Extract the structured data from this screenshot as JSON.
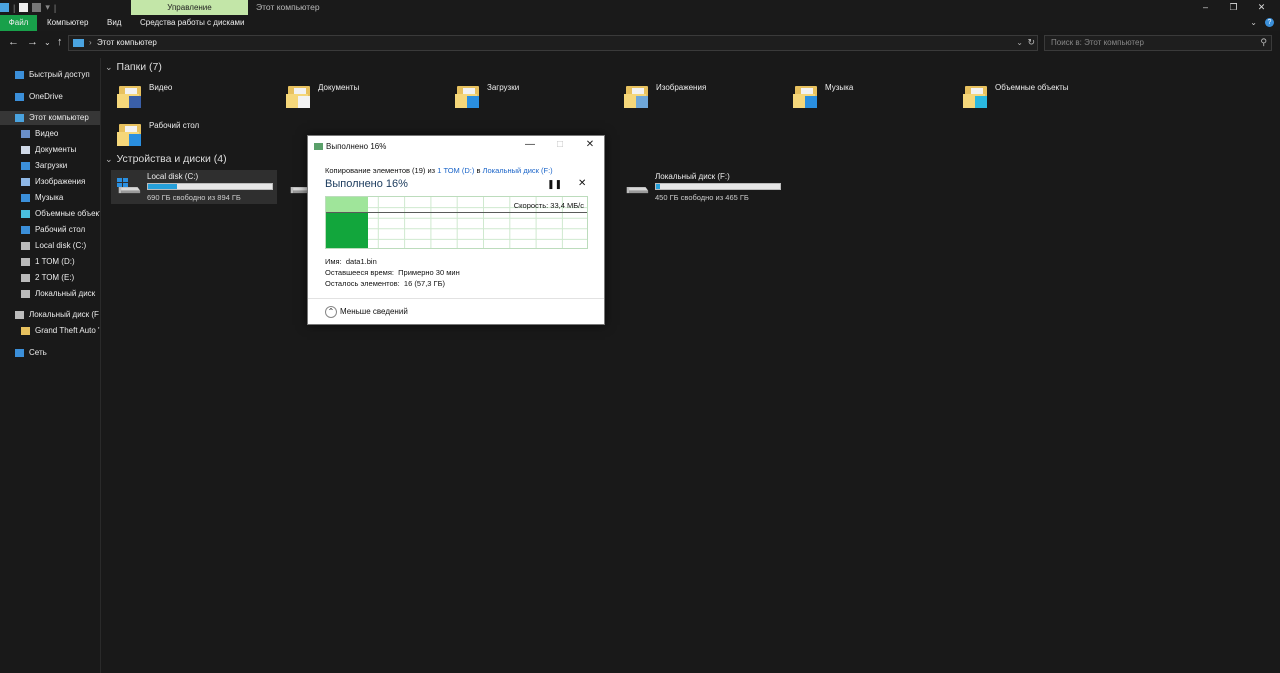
{
  "titlebar": {
    "manage_tab": "Управление",
    "title": "Этот компьютер",
    "controls": [
      "–",
      "❐",
      "✕"
    ]
  },
  "ribbon": {
    "tabs": [
      "Файл",
      "Компьютер",
      "Вид",
      "Средства работы с дисками"
    ],
    "right_icons": [
      "chevron-down-icon",
      "help-icon"
    ]
  },
  "address": {
    "back": "←",
    "forward": "→",
    "dropdown": "⌄",
    "up": "↑",
    "path": "Этот компьютер",
    "search_placeholder": "Поиск в: Этот компьютер"
  },
  "sidebar": {
    "items": [
      {
        "label": "Быстрый доступ",
        "icon": "star-icon",
        "color": "#3b8fd9"
      },
      {
        "label": "OneDrive",
        "icon": "cloud-icon",
        "color": "#3b8fd9"
      },
      {
        "label": "Этот компьютер",
        "icon": "pc-icon",
        "color": "#4aa3df"
      },
      {
        "label": "Видео",
        "icon": "video-icon",
        "color": "#6a8fc9"
      },
      {
        "label": "Документы",
        "icon": "documents-icon",
        "color": "#cfd8e6"
      },
      {
        "label": "Загрузки",
        "icon": "downloads-icon",
        "color": "#3b8fd9"
      },
      {
        "label": "Изображения",
        "icon": "images-icon",
        "color": "#8fb8e6"
      },
      {
        "label": "Музыка",
        "icon": "music-icon",
        "color": "#3b8fd9"
      },
      {
        "label": "Объемные объекты",
        "icon": "3d-objects-icon",
        "color": "#4ac0e0"
      },
      {
        "label": "Рабочий стол",
        "icon": "desktop-icon",
        "color": "#3b8fd9"
      },
      {
        "label": "Local disk (C:)",
        "icon": "drive-icon",
        "color": "#bbbbbb"
      },
      {
        "label": "1 ТОМ (D:)",
        "icon": "drive-icon",
        "color": "#bbbbbb"
      },
      {
        "label": "2 ТОМ (E:)",
        "icon": "drive-icon",
        "color": "#bbbbbb"
      },
      {
        "label": "Локальный диск",
        "icon": "drive-icon",
        "color": "#bbbbbb"
      },
      {
        "label": "Локальный диск (F",
        "icon": "drive-icon",
        "color": "#bbbbbb"
      },
      {
        "label": "Grand Theft Auto '",
        "icon": "folder-icon",
        "color": "#e7c15f"
      },
      {
        "label": "Сеть",
        "icon": "network-icon",
        "color": "#3b8fd9"
      }
    ]
  },
  "folders_group": {
    "chevron": "⌄",
    "label": "Папки (7)",
    "items": [
      {
        "name": "Видео",
        "badge": "video-icon"
      },
      {
        "name": "Документы",
        "badge": "documents-icon"
      },
      {
        "name": "Загрузки",
        "badge": "downloads-icon"
      },
      {
        "name": "Изображения",
        "badge": "images-icon"
      },
      {
        "name": "Музыка",
        "badge": "music-icon"
      },
      {
        "name": "Объемные объекты",
        "badge": "3d-objects-icon"
      },
      {
        "name": "Рабочий стол",
        "badge": "desktop-icon"
      }
    ]
  },
  "drives_group": {
    "chevron": "⌄",
    "label": "Устройства и диски (4)",
    "items": [
      {
        "name": "Local disk (C:)",
        "free": "690 ГБ свободно из 894 ГБ",
        "used_fraction": 0.23
      },
      {
        "name": "Локальный диск (F:)",
        "free": "450 ГБ свободно из 465 ГБ",
        "used_fraction": 0.03
      }
    ]
  },
  "copy_dialog": {
    "title": "Выполнено 16%",
    "controls": [
      "—",
      "□",
      "✕"
    ],
    "line_prefix": "Копирование элементов (19) из ",
    "source": "1 ТОМ (D:)",
    "line_mid": " в ",
    "destination": "Локальный диск (F:)",
    "progress_text": "Выполнено 16%",
    "progress": 0.16,
    "pause": "❚❚",
    "stop": "✕",
    "speed": "Скорость: 33,4 МБ/с",
    "name_label": "Имя:",
    "name_value": "data1.bin",
    "time_label": "Оставшееся время:",
    "time_value": "Примерно 30 мин",
    "items_label": "Осталось элементов:",
    "items_value": "16 (57,3 ГБ)",
    "less_arrow": "⌃",
    "less_details": "Меньше сведений",
    "accent": "#12a63c"
  }
}
